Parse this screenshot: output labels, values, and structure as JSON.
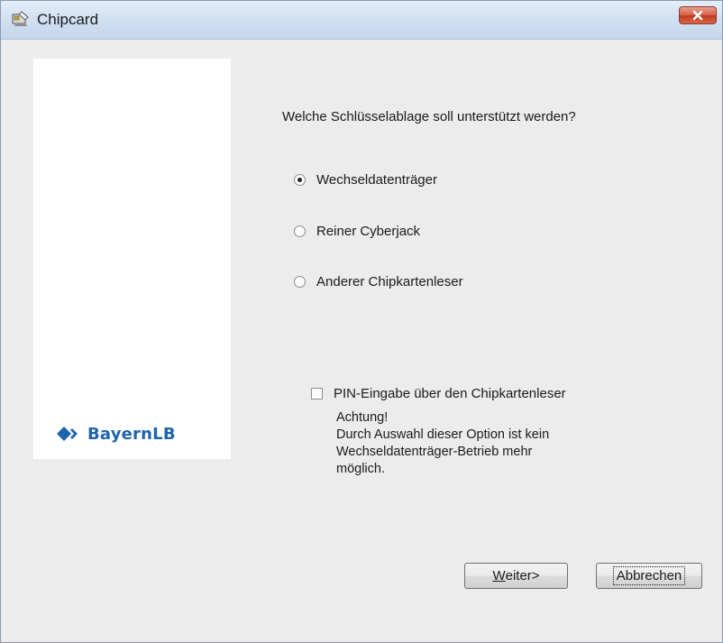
{
  "window": {
    "title": "Chipcard"
  },
  "logo": {
    "text": "BayernLB",
    "color": "#1e64ad"
  },
  "question": "Welche Schlüsselablage soll unterstützt werden?",
  "options": [
    {
      "label": "Wechseldatenträger",
      "checked": true
    },
    {
      "label": "Reiner Cyberjack",
      "checked": false
    },
    {
      "label": "Anderer Chipkartenleser",
      "checked": false
    }
  ],
  "pin_checkbox": {
    "label": "PIN-Eingabe über den Chipkartenleser",
    "checked": false
  },
  "warning": {
    "line1": "Achtung!",
    "line2": "Durch Auswahl dieser Option ist kein",
    "line3": "Wechseldatenträger-Betrieb mehr",
    "line4": "möglich."
  },
  "buttons": {
    "next_accel": "W",
    "next_rest": "eiter>",
    "cancel": "Abbrechen"
  }
}
